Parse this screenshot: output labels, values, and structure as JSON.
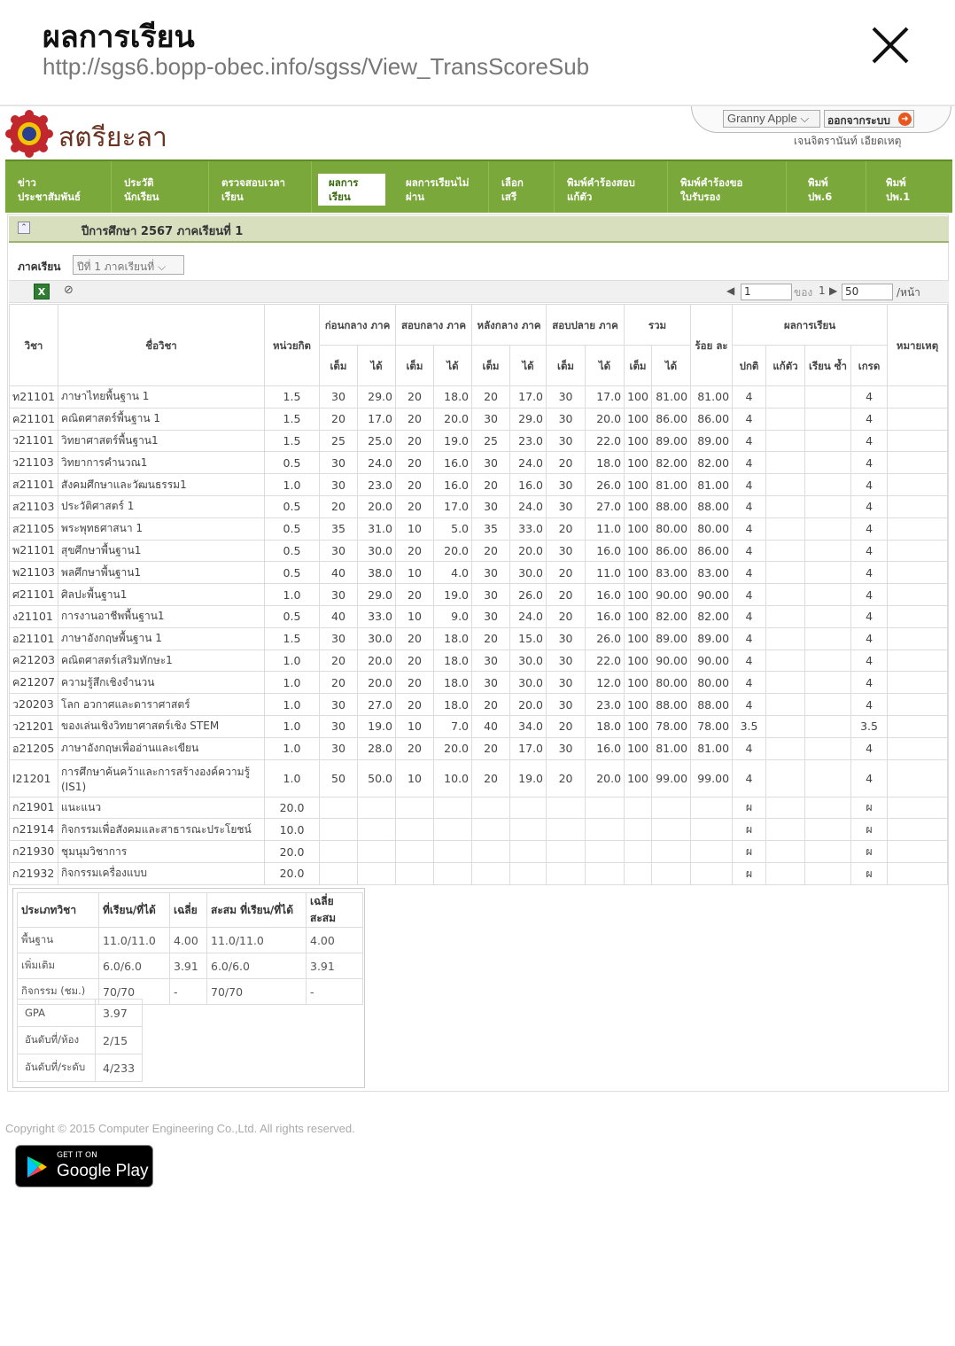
{
  "window": {
    "title": "ผลการเรียน",
    "url": "http://sgs6.bopp-obec.info/sgss/View_TransScoreSub"
  },
  "header": {
    "school_name": "สตรียะลา",
    "user_select": "Granny Apple",
    "logout_label": "ออกจากระบบ",
    "user_name": "เจนจิตรานันท์  เอียดเหตุ"
  },
  "nav": [
    {
      "line1": "ข่าว",
      "line2": "ประชาสัมพันธ์"
    },
    {
      "line1": "ประวัติ",
      "line2": "นักเรียน"
    },
    {
      "line1": "ตรวจสอบเวลา",
      "line2": "เรียน"
    },
    {
      "line1": "ผลการ",
      "line2": "เรียน"
    },
    {
      "line1": "ผลการเรียนไม่",
      "line2": "ผ่าน"
    },
    {
      "line1": "เลือก",
      "line2": "เสรี"
    },
    {
      "line1": "พิมพ์คำร้องสอบ",
      "line2": "แก้ตัว"
    },
    {
      "line1": "พิมพ์คำร้องขอ",
      "line2": "ใบรับรอง"
    },
    {
      "line1": "พิมพ์",
      "line2": "ปพ.6"
    },
    {
      "line1": "พิมพ์",
      "line2": "ปพ.1"
    }
  ],
  "year_bar": "ปีการศึกษา  2567  ภาคเรียนที่  1",
  "semester": {
    "label": "ภาคเรียน",
    "selected": "ปีที่  1  ภาคเรียนที่"
  },
  "pager": {
    "page": "1",
    "of_label": "ของ",
    "total": "1",
    "per_page": "50",
    "per_label": "/หน้า"
  },
  "columns": {
    "code": "วิชา",
    "name": "ชื่อวิชา",
    "credit": "หน่วยกิต",
    "before_mid": "ก่อนกลาง ภาค",
    "mid": "สอบกลาง ภาค",
    "after_mid": "หลังกลาง ภาค",
    "final": "สอบปลาย ภาค",
    "total": "รวม",
    "percent": "ร้อย ละ",
    "result": "ผลการเรียน",
    "remark": "หมายเหตุ",
    "full": "เต็ม",
    "got": "ได้",
    "normal": "ปกติ",
    "fix": "แก้ตัว",
    "repeat": "เรียน ซ้ำ",
    "grade": "เกรด"
  },
  "rows": [
    [
      "ท21101",
      "ภาษาไทยพื้นฐาน  1",
      "1.5",
      "30",
      "29.0",
      "20",
      "18.0",
      "20",
      "17.0",
      "30",
      "17.0",
      "100",
      "81.00",
      "81.00",
      "4",
      "",
      "",
      "4",
      ""
    ],
    [
      "ค21101",
      "คณิตศาสตร์พื้นฐาน  1",
      "1.5",
      "20",
      "17.0",
      "20",
      "20.0",
      "30",
      "29.0",
      "30",
      "20.0",
      "100",
      "86.00",
      "86.00",
      "4",
      "",
      "",
      "4",
      ""
    ],
    [
      "ว21101",
      "วิทยาศาสตร์พื้นฐาน1",
      "1.5",
      "25",
      "25.0",
      "20",
      "19.0",
      "25",
      "23.0",
      "30",
      "22.0",
      "100",
      "89.00",
      "89.00",
      "4",
      "",
      "",
      "4",
      ""
    ],
    [
      "ว21103",
      "วิทยาการคำนวณ1",
      "0.5",
      "30",
      "24.0",
      "20",
      "16.0",
      "30",
      "24.0",
      "20",
      "18.0",
      "100",
      "82.00",
      "82.00",
      "4",
      "",
      "",
      "4",
      ""
    ],
    [
      "ส21101",
      "สังคมศึกษาและวัฒนธรรม1",
      "1.0",
      "30",
      "23.0",
      "20",
      "16.0",
      "20",
      "16.0",
      "30",
      "26.0",
      "100",
      "81.00",
      "81.00",
      "4",
      "",
      "",
      "4",
      ""
    ],
    [
      "ส21103",
      "ประวัติศาสตร์  1",
      "0.5",
      "20",
      "20.0",
      "20",
      "17.0",
      "30",
      "24.0",
      "30",
      "27.0",
      "100",
      "88.00",
      "88.00",
      "4",
      "",
      "",
      "4",
      ""
    ],
    [
      "ส21105",
      "พระพุทธศาสนา  1",
      "0.5",
      "35",
      "31.0",
      "10",
      "5.0",
      "35",
      "33.0",
      "20",
      "11.0",
      "100",
      "80.00",
      "80.00",
      "4",
      "",
      "",
      "4",
      ""
    ],
    [
      "พ21101",
      "สุขศึกษาพื้นฐาน1",
      "0.5",
      "30",
      "30.0",
      "20",
      "20.0",
      "20",
      "20.0",
      "30",
      "16.0",
      "100",
      "86.00",
      "86.00",
      "4",
      "",
      "",
      "4",
      ""
    ],
    [
      "พ21103",
      "พลศึกษาพื้นฐาน1",
      "0.5",
      "40",
      "38.0",
      "10",
      "4.0",
      "30",
      "30.0",
      "20",
      "11.0",
      "100",
      "83.00",
      "83.00",
      "4",
      "",
      "",
      "4",
      ""
    ],
    [
      "ศ21101",
      "ศิลปะพื้นฐาน1",
      "1.0",
      "30",
      "29.0",
      "20",
      "19.0",
      "30",
      "26.0",
      "20",
      "16.0",
      "100",
      "90.00",
      "90.00",
      "4",
      "",
      "",
      "4",
      ""
    ],
    [
      "ง21101",
      "การงานอาชีพพื้นฐาน1",
      "0.5",
      "40",
      "33.0",
      "10",
      "9.0",
      "30",
      "24.0",
      "20",
      "16.0",
      "100",
      "82.00",
      "82.00",
      "4",
      "",
      "",
      "4",
      ""
    ],
    [
      "อ21101",
      "ภาษาอังกฤษพื้นฐาน  1",
      "1.5",
      "30",
      "30.0",
      "20",
      "18.0",
      "20",
      "15.0",
      "30",
      "26.0",
      "100",
      "89.00",
      "89.00",
      "4",
      "",
      "",
      "4",
      ""
    ],
    [
      "ค21203",
      "คณิตศาสตร์เสริมทักษะ1",
      "1.0",
      "20",
      "20.0",
      "20",
      "18.0",
      "30",
      "30.0",
      "30",
      "22.0",
      "100",
      "90.00",
      "90.00",
      "4",
      "",
      "",
      "4",
      ""
    ],
    [
      "ค21207",
      "ความรู้สึกเชิงจำนวน",
      "1.0",
      "20",
      "20.0",
      "20",
      "18.0",
      "30",
      "30.0",
      "30",
      "12.0",
      "100",
      "80.00",
      "80.00",
      "4",
      "",
      "",
      "4",
      ""
    ],
    [
      "ว20203",
      "โลก  อวกาศและดาราศาสตร์",
      "1.0",
      "30",
      "27.0",
      "20",
      "18.0",
      "20",
      "20.0",
      "30",
      "23.0",
      "100",
      "88.00",
      "88.00",
      "4",
      "",
      "",
      "4",
      ""
    ],
    [
      "ว21201",
      "ของเล่นเชิงวิทยาศาสตร์เชิง  STEM",
      "1.0",
      "30",
      "19.0",
      "10",
      "7.0",
      "40",
      "34.0",
      "20",
      "18.0",
      "100",
      "78.00",
      "78.00",
      "3.5",
      "",
      "",
      "3.5",
      ""
    ],
    [
      "อ21205",
      "ภาษาอังกฤษเพื่ออ่านและเขียน",
      "1.0",
      "30",
      "28.0",
      "20",
      "20.0",
      "20",
      "17.0",
      "30",
      "16.0",
      "100",
      "81.00",
      "81.00",
      "4",
      "",
      "",
      "4",
      ""
    ],
    [
      "I21201",
      "การศึกษาค้นคว้าและการสร้างองค์ความรู้ (IS1)",
      "1.0",
      "50",
      "50.0",
      "10",
      "10.0",
      "20",
      "19.0",
      "20",
      "20.0",
      "100",
      "99.00",
      "99.00",
      "4",
      "",
      "",
      "4",
      ""
    ],
    [
      "ก21901",
      "แนะแนว",
      "20.0",
      "",
      "",
      "",
      "",
      "",
      "",
      "",
      "",
      "",
      "",
      "",
      "ผ",
      "",
      "",
      "ผ",
      ""
    ],
    [
      "ก21914",
      "กิจกรรมเพื่อสังคมและสาธารณะประโยชน์",
      "10.0",
      "",
      "",
      "",
      "",
      "",
      "",
      "",
      "",
      "",
      "",
      "",
      "ผ",
      "",
      "",
      "ผ",
      ""
    ],
    [
      "ก21930",
      "ชุมนุมวิชาการ",
      "20.0",
      "",
      "",
      "",
      "",
      "",
      "",
      "",
      "",
      "",
      "",
      "",
      "ผ",
      "",
      "",
      "ผ",
      ""
    ],
    [
      "ก21932",
      "กิจกรรมเครื่องแบบ",
      "20.0",
      "",
      "",
      "",
      "",
      "",
      "",
      "",
      "",
      "",
      "",
      "",
      "ผ",
      "",
      "",
      "ผ",
      ""
    ]
  ],
  "summary": {
    "headers": [
      "ประเภทวิชา",
      "ที่เรียน/ที่ได้",
      "เฉลี่ย",
      "สะสม  ที่เรียน/ที่ได้",
      "เฉลี่ยสะสม"
    ],
    "rows": [
      [
        "พื้นฐาน",
        "11.0/11.0",
        "4.00",
        "11.0/11.0",
        "4.00"
      ],
      [
        "เพิ่มเติม",
        "6.0/6.0",
        "3.91",
        "6.0/6.0",
        "3.91"
      ],
      [
        "กิจกรรม  (ชม.)",
        "70/70",
        "-",
        "70/70",
        "-"
      ]
    ],
    "gpa": [
      [
        "GPA",
        "3.97"
      ],
      [
        "อันดับที่/ห้อง",
        "2/15"
      ],
      [
        "อันดับที่/ระดับ",
        "4/233"
      ]
    ]
  },
  "footer": {
    "copyright": "Copyright © 2015 Computer Engineering Co.,Ltd. All rights reserved.",
    "gplay_small": "GET IT ON",
    "gplay_big": "Google Play"
  }
}
